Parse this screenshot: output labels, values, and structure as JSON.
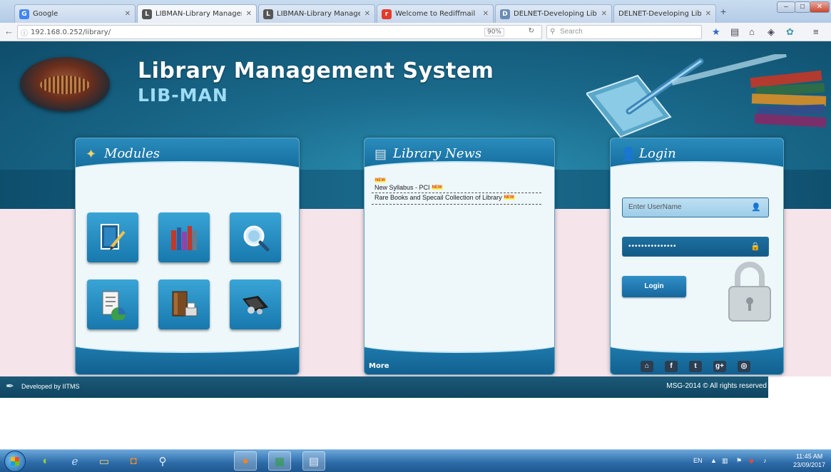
{
  "browser": {
    "tabs": [
      {
        "title": "Google",
        "favicon": "G",
        "color": "#4285f4"
      },
      {
        "title": "LIBMAN-Library Managem",
        "favicon": "L",
        "color": "#555555",
        "active": true
      },
      {
        "title": "LIBMAN-Library Managem",
        "favicon": "L",
        "color": "#555555"
      },
      {
        "title": "Welcome to Rediffmail",
        "favicon": "r",
        "color": "#e33b2b"
      },
      {
        "title": "DELNET-Developing Libra",
        "favicon": "D",
        "color": "#6a8bb5"
      },
      {
        "title": "DELNET-Developing Library N",
        "favicon": "",
        "color": "#ffffff"
      }
    ],
    "new_tab": "+",
    "url": "192.168.0.252/library/",
    "zoom": "90%",
    "search_placeholder": "Search"
  },
  "header": {
    "title": "Library Management System",
    "subtitle": "LIB-MAN"
  },
  "panels": {
    "modules": {
      "title": "Modules",
      "items": [
        {
          "name": "cataloguing",
          "icon": "notebook-pen-icon"
        },
        {
          "name": "books",
          "icon": "books-stack-icon"
        },
        {
          "name": "search",
          "icon": "magnifier-icon"
        },
        {
          "name": "reports",
          "icon": "report-chart-icon"
        },
        {
          "name": "documents",
          "icon": "book-printer-icon"
        },
        {
          "name": "circulation",
          "icon": "hands-book-icon"
        }
      ]
    },
    "news": {
      "title": "Library News",
      "new_badge": "NEW",
      "items": [
        "New Syllabus - PCI",
        "Rare Books and Specail Collection of Library"
      ],
      "more": "More"
    },
    "login": {
      "title": "Login",
      "username_placeholder": "Enter UserName",
      "password_value": "•••••••••••••••",
      "button": "Login",
      "social": [
        {
          "name": "home",
          "glyph": "⌂"
        },
        {
          "name": "facebook",
          "glyph": "f"
        },
        {
          "name": "twitter",
          "glyph": "t"
        },
        {
          "name": "google-plus",
          "glyph": "g+"
        },
        {
          "name": "flickr",
          "glyph": "◎"
        }
      ]
    }
  },
  "footer": {
    "developed_by": "Developed by IITMS",
    "copyright": "MSG-2014 © All rights reserved"
  },
  "taskbar": {
    "language": "EN",
    "time": "11:45 AM",
    "date": "23/09/2017"
  },
  "colors": {
    "header_dark": "#0f4d6b",
    "panel_blue": "#1778ad",
    "body_pink": "#f5e4ea"
  }
}
